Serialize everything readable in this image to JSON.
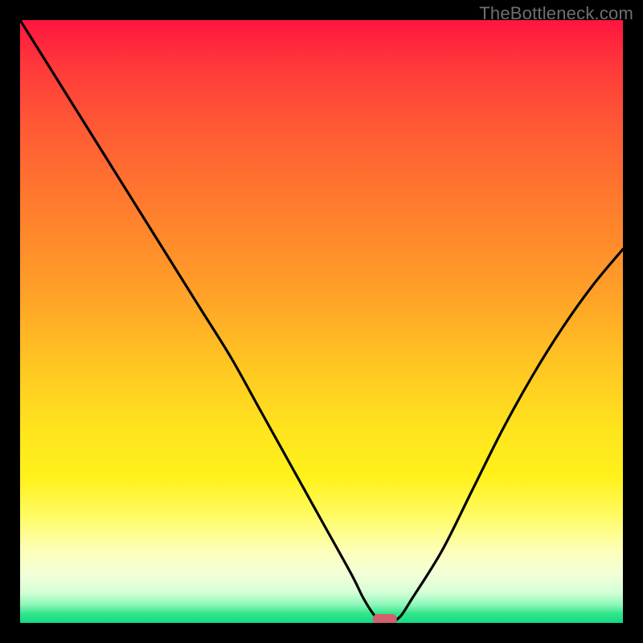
{
  "watermark": "TheBottleneck.com",
  "chart_data": {
    "type": "line",
    "title": "",
    "xlabel": "",
    "ylabel": "",
    "xlim": [
      0,
      100
    ],
    "ylim": [
      0,
      100
    ],
    "grid": false,
    "legend": false,
    "background": "rainbow-gradient-vertical",
    "series": [
      {
        "name": "bottleneck-curve",
        "x": [
          0,
          5,
          10,
          15,
          20,
          25,
          30,
          35,
          40,
          45,
          50,
          55,
          57,
          59,
          61,
          63,
          65,
          70,
          75,
          80,
          85,
          90,
          95,
          100
        ],
        "y": [
          100,
          92,
          84,
          76,
          68,
          60,
          52,
          44,
          35,
          26,
          17,
          8,
          4,
          1,
          0,
          1,
          4,
          12,
          22,
          32,
          41,
          49,
          56,
          62
        ]
      }
    ],
    "annotations": [
      {
        "name": "minimum-marker",
        "x": 60.5,
        "y": 0,
        "shape": "pill",
        "color": "#d1616c"
      }
    ],
    "gradient_stops": [
      {
        "pos": 0.0,
        "color": "#ff153f"
      },
      {
        "pos": 0.3,
        "color": "#ff7a2e"
      },
      {
        "pos": 0.6,
        "color": "#ffe41e"
      },
      {
        "pos": 0.9,
        "color": "#fdffb8"
      },
      {
        "pos": 1.0,
        "color": "#13db86"
      }
    ]
  }
}
